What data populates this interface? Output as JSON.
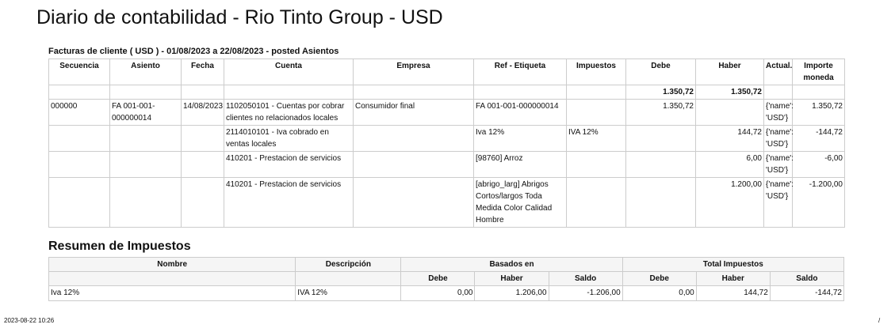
{
  "title": "Diario de contabilidad - Rio Tinto Group - USD",
  "subtitle": "Facturas de cliente ( USD ) - 01/08/2023 a 22/08/2023 - posted Asientos",
  "journal": {
    "headers": [
      "Secuencia",
      "Asiento",
      "Fecha",
      "Cuenta",
      "Empresa",
      "Ref - Etiqueta",
      "Impuestos",
      "Debe",
      "Haber",
      "Actual.",
      "Importe moneda"
    ],
    "totals": {
      "debe": "1.350,72",
      "haber": "1.350,72"
    },
    "rows": [
      {
        "secuencia": "000000",
        "asiento": "FA 001-001-000000014",
        "fecha": "14/08/2023",
        "cuenta": "1102050101 - Cuentas por cobrar clientes no relacionados locales",
        "empresa": "Consumidor final",
        "ref": "FA 001-001-000000014",
        "impuestos": "",
        "debe": "1.350,72",
        "haber": "",
        "actual": "{'name': 'USD'}",
        "importe": "1.350,72"
      },
      {
        "secuencia": "",
        "asiento": "",
        "fecha": "",
        "cuenta": "2114010101 - Iva cobrado en ventas locales",
        "empresa": "",
        "ref": "Iva 12%",
        "impuestos": "IVA 12%",
        "debe": "",
        "haber": "144,72",
        "actual": "{'name': 'USD'}",
        "importe": "-144,72"
      },
      {
        "secuencia": "",
        "asiento": "",
        "fecha": "",
        "cuenta": "410201 - Prestacion de servicios",
        "empresa": "",
        "ref": "[98760] Arroz",
        "impuestos": "",
        "debe": "",
        "haber": "6,00",
        "actual": "{'name': 'USD'}",
        "importe": "-6,00"
      },
      {
        "secuencia": "",
        "asiento": "",
        "fecha": "",
        "cuenta": "410201 - Prestacion de servicios",
        "empresa": "",
        "ref": "[abrigo_larg] Abrigos Cortos/largos Toda Medida Color Calidad Hombre",
        "impuestos": "",
        "debe": "",
        "haber": "1.200,00",
        "actual": "{'name': 'USD'}",
        "importe": "-1.200,00"
      }
    ]
  },
  "tax_summary": {
    "heading": "Resumen de Impuestos",
    "headers": {
      "nombre": "Nombre",
      "descripcion": "Descripción",
      "basados": "Basados en",
      "total": "Total Impuestos"
    },
    "sub_headers": [
      "Debe",
      "Haber",
      "Saldo",
      "Debe",
      "Haber",
      "Saldo"
    ],
    "rows": [
      {
        "nombre": "Iva 12%",
        "descripcion": "IVA 12%",
        "b_debe": "0,00",
        "b_haber": "1.206,00",
        "b_saldo": "-1.206,00",
        "t_debe": "0,00",
        "t_haber": "144,72",
        "t_saldo": "-144,72"
      }
    ]
  },
  "footer": {
    "timestamp": "2023-08-22 10:26",
    "page": "/"
  }
}
